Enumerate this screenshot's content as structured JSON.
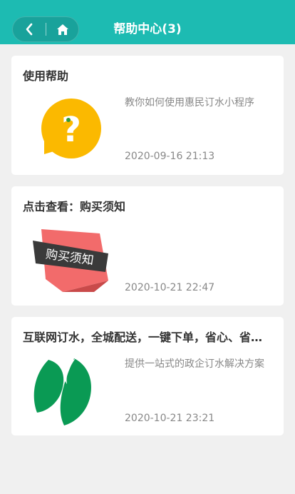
{
  "header": {
    "title": "帮助中心(3)",
    "back_icon": "chevron-left-icon",
    "home_icon": "home-icon",
    "color": "#1dbbb2"
  },
  "articles": [
    {
      "title": "使用帮助",
      "description": "教你如何使用惠民订水小程序",
      "date": "2020-09-16 21:13",
      "thumb_icon": "question-bubble-icon"
    },
    {
      "title": "点击查看：购买须知",
      "description": "",
      "date": "2020-10-21 22:47",
      "thumb_icon": "purchase-notice-banner-image",
      "thumb_text": "购买须知"
    },
    {
      "title": "互联网订水，全城配送，一键下单，省心、省力、放心",
      "description": "提供一站式的政企订水解决方案",
      "date": "2020-10-21 23:21",
      "thumb_icon": "green-leaf-logo-image"
    }
  ]
}
